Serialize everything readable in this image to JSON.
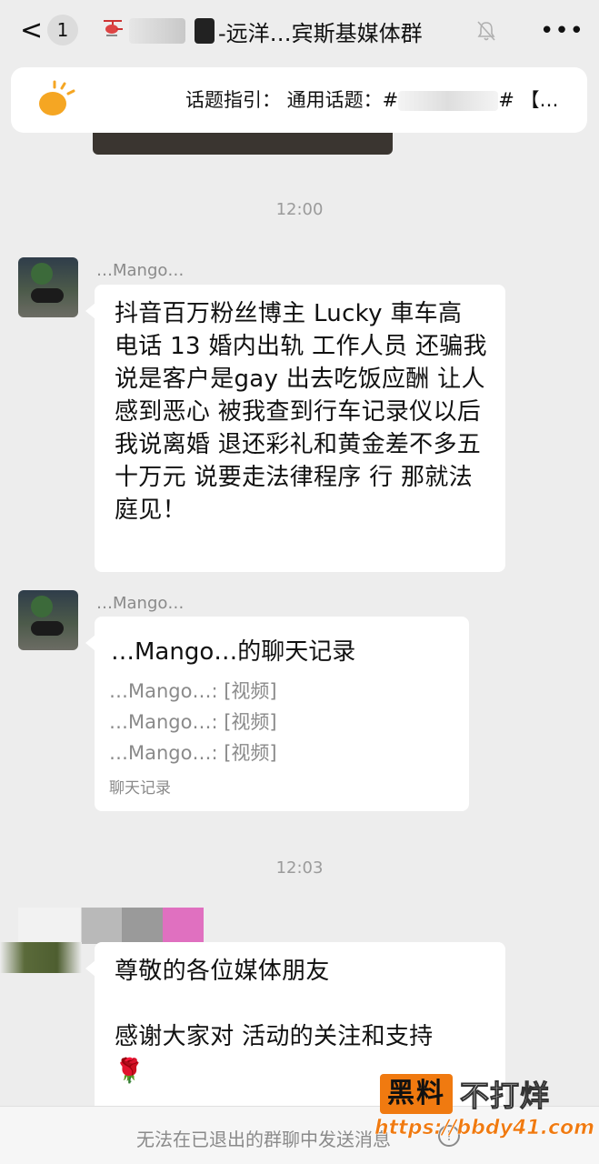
{
  "header": {
    "back_glyph": "<",
    "unread_count": "1",
    "title_prefix_icon": "helicopter-icon",
    "title_visible": "-远洋…宾斯基媒体群",
    "mute_icon": "bell-slash-icon",
    "more_glyph": "•••"
  },
  "pinned_topic": {
    "icon": "lightbulb-icon",
    "text_start": "话题指引：  通用话题：#",
    "text_end": "#  【…"
  },
  "timestamps": [
    "12:00",
    "12:03"
  ],
  "messages": [
    {
      "sender": "…Mango…",
      "text": "抖音百万粉丝博主 Lucky    車车高    电话          13 婚内出轨     工作人员 还骗我说是客户是gay 出去吃饭应酬 让人感到恶心 被我查到行车记录仪以后 我说离婚 退还彩礼和黄金差不多五十万元 说要走法律程序 行 那就法庭见！"
    },
    {
      "sender": "…Mango…",
      "card": {
        "title": "…Mango…的聊天记录",
        "lines": [
          "…Mango…: [视频]",
          "…Mango…: [视频]",
          "…Mango…: [视频]"
        ],
        "footer": "聊天记录"
      }
    },
    {
      "sender": "",
      "text_line1": "尊敬的各位媒体朋友",
      "text_line2": "感谢大家对     活动的关注和支持",
      "emoji": "🌹"
    }
  ],
  "bottom_bar": {
    "notice": "无法在已退出的群聊中发送消息",
    "info_glyph": "!"
  },
  "watermark": {
    "logo_box": "黑料",
    "logo_rest": "不打烊",
    "url": "https://bbdy41.com"
  }
}
